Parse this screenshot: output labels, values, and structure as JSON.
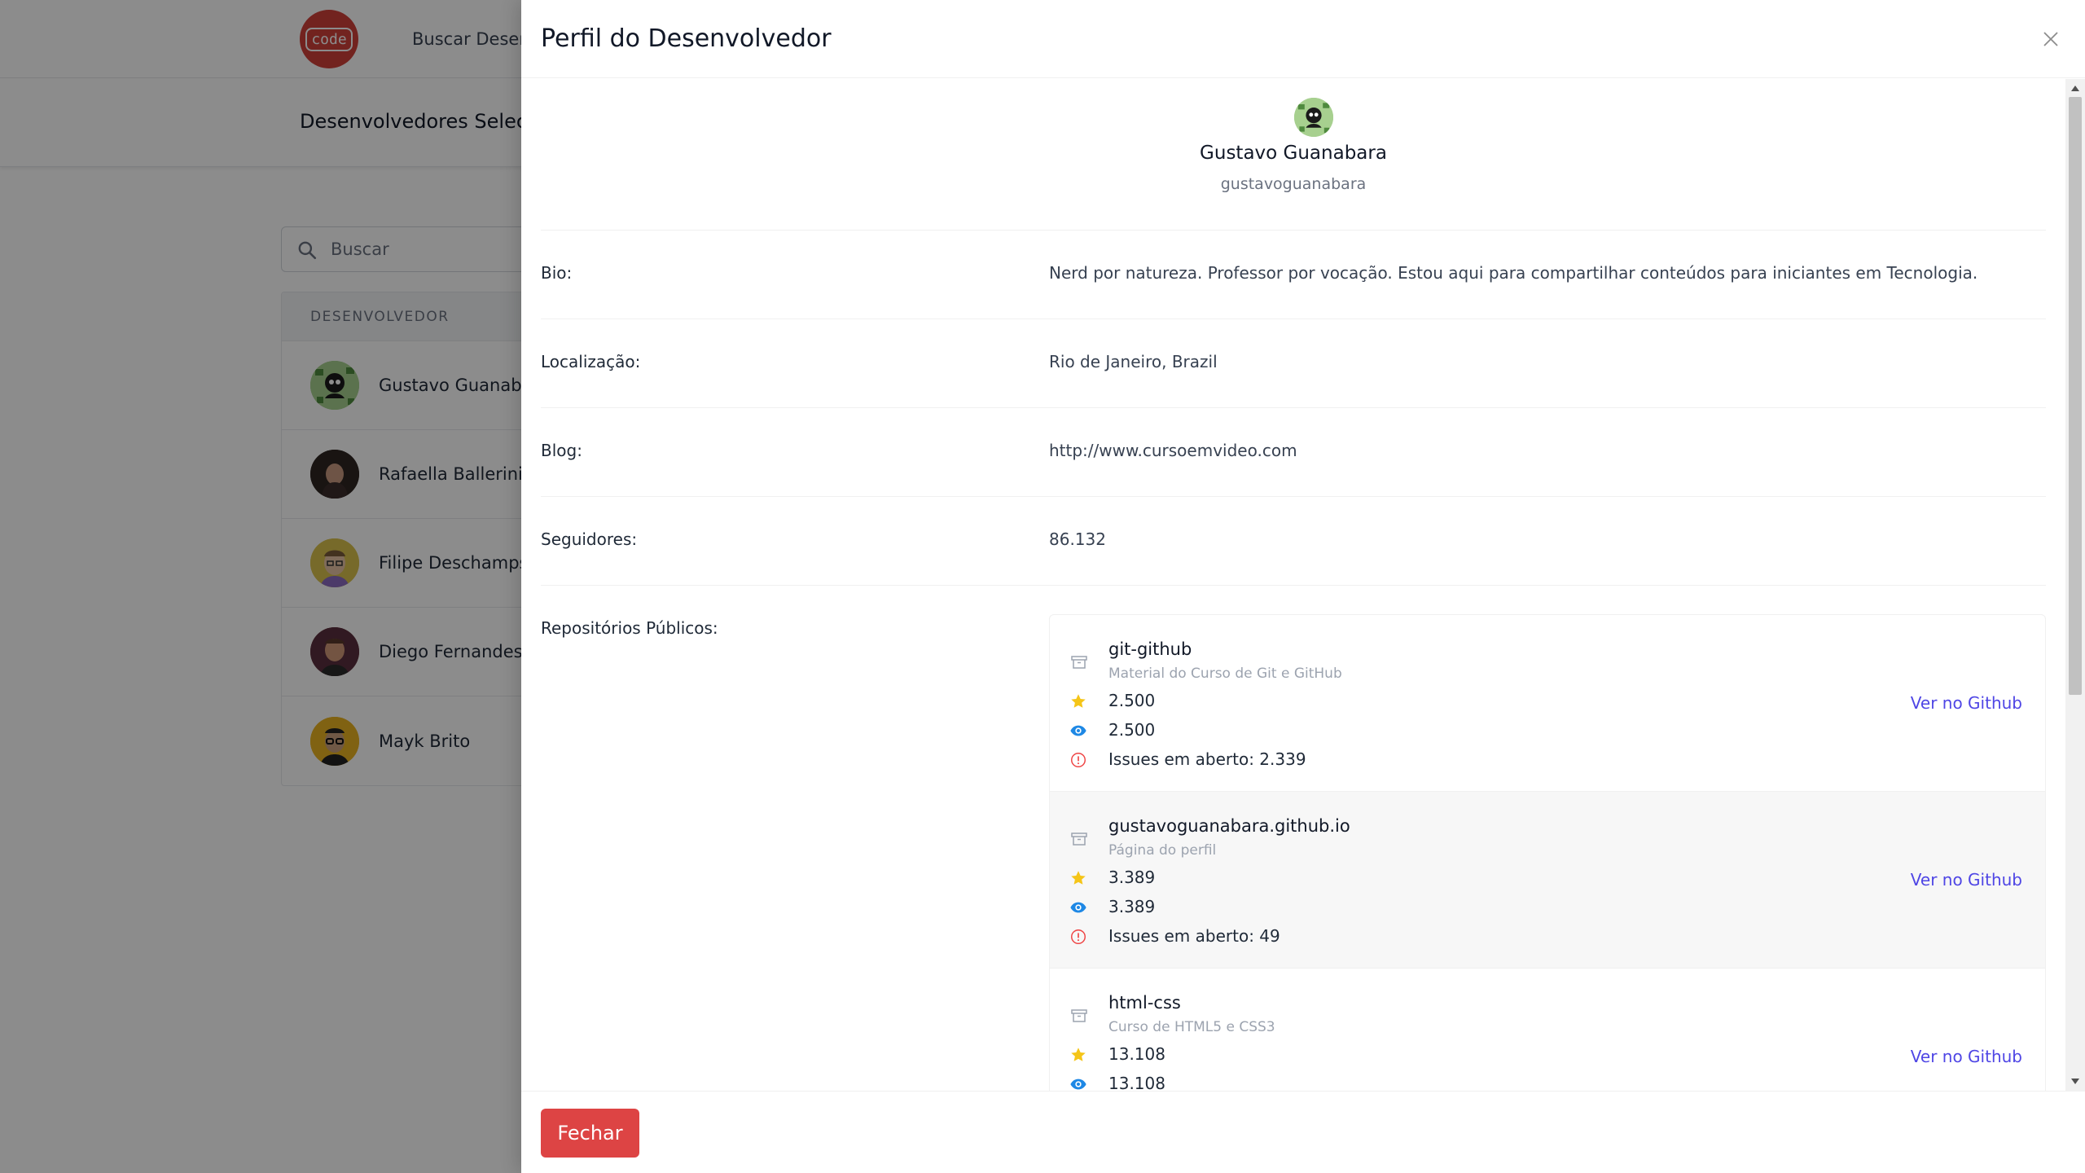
{
  "app": {
    "logo_text": "code",
    "nav_link": "Buscar Desenvolvedores",
    "subheader_title": "Desenvolvedores Selecionados",
    "search": {
      "placeholder": "Buscar"
    },
    "table": {
      "header": "DESENVOLVEDOR",
      "rows": [
        {
          "name": "Gustavo Guanabara",
          "avatar_color": "#8fbf7a"
        },
        {
          "name": "Rafaella Ballerini",
          "avatar_color": "#3a2a26"
        },
        {
          "name": "Filipe Deschamps",
          "avatar_color": "#d8c04a"
        },
        {
          "name": "Diego Fernandes",
          "avatar_color": "#7a3a2e"
        },
        {
          "name": "Mayk Brito",
          "avatar_color": "#e8b020"
        }
      ]
    }
  },
  "drawer": {
    "title": "Perfil do Desenvolvedor",
    "profile": {
      "name": "Gustavo Guanabara",
      "login": "gustavoguanabara"
    },
    "fields": [
      {
        "label": "Bio:",
        "value": "Nerd por natureza. Professor por vocação. Estou aqui para compartilhar conteúdos para iniciantes em Tecnologia."
      },
      {
        "label": "Localização:",
        "value": "Rio de Janeiro, Brazil"
      },
      {
        "label": "Blog:",
        "value": "http://www.cursoemvideo.com"
      },
      {
        "label": "Seguidores:",
        "value": "86.132"
      }
    ],
    "repos_label": "Repositórios Públicos:",
    "repos": [
      {
        "name": "git-github",
        "description": "Material do Curso de Git e GitHub",
        "stars": "2.500",
        "watchers": "2.500",
        "issues": "Issues em aberto: 2.339",
        "link": "Ver no Github"
      },
      {
        "name": "gustavoguanabara.github.io",
        "description": "Página do perfil",
        "stars": "3.389",
        "watchers": "3.389",
        "issues": "Issues em aberto: 49",
        "link": "Ver no Github"
      },
      {
        "name": "html-css",
        "description": "Curso de HTML5 e CSS3",
        "stars": "13.108",
        "watchers": "13.108",
        "issues": "",
        "link": "Ver no Github"
      }
    ],
    "close_button": "Fechar"
  },
  "colors": {
    "brand": "#d0403a",
    "primary_button": "#dd4444",
    "link": "#4f46e5",
    "star": "#f5c518",
    "eye": "#1e88e5",
    "issue": "#ef4444"
  },
  "icons": [
    "search-icon",
    "close-icon",
    "archive-icon",
    "star-icon",
    "eye-icon",
    "alert-circle-icon"
  ]
}
